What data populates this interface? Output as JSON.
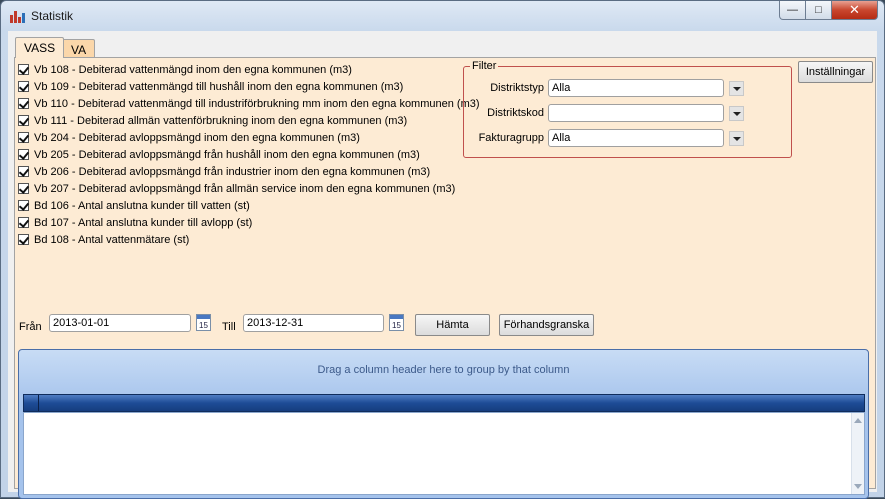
{
  "window": {
    "title": "Statistik",
    "controls": {
      "minimize": "—",
      "maximize": "□",
      "close": "✕"
    }
  },
  "tabs": [
    {
      "label": "VASS",
      "active": true
    },
    {
      "label": "VA",
      "active": false
    }
  ],
  "checkboxes": [
    {
      "label": "Vb 108 - Debiterad vattenmängd inom den egna kommunen (m3)",
      "checked": true
    },
    {
      "label": "Vb 109 - Debiterad vattenmängd till hushåll inom den egna kommunen (m3)",
      "checked": true
    },
    {
      "label": "Vb 110 - Debiterad vattenmängd till industriförbrukning mm inom den egna kommunen (m3)",
      "checked": true
    },
    {
      "label": "Vb 111 - Debiterad allmän vattenförbrukning inom den egna kommunen (m3)",
      "checked": true
    },
    {
      "label": "Vb 204 - Debiterad avloppsmängd inom den egna kommunen (m3)",
      "checked": true
    },
    {
      "label": "Vb 205 - Debiterad avloppsmängd från hushåll inom den egna kommunen (m3)",
      "checked": true
    },
    {
      "label": "Vb 206 - Debiterad avloppsmängd från industrier inom den egna kommunen (m3)",
      "checked": true
    },
    {
      "label": "Vb 207 - Debiterad avloppsmängd från allmän service inom den egna kommunen (m3)",
      "checked": true
    },
    {
      "label": "Bd 106 - Antal anslutna kunder till vatten (st)",
      "checked": true
    },
    {
      "label": "Bd 107 - Antal anslutna kunder till avlopp (st)",
      "checked": true
    },
    {
      "label": "Bd 108 - Antal vattenmätare (st)",
      "checked": true
    }
  ],
  "filter": {
    "legend": "Filter",
    "distriktstyp": {
      "label": "Distriktstyp",
      "value": "Alla"
    },
    "distriktskod": {
      "label": "Distriktskod",
      "value": ""
    },
    "fakturagrupp": {
      "label": "Fakturagrupp",
      "value": "Alla"
    }
  },
  "settings_button": "Inställningar",
  "dates": {
    "from_label": "Från",
    "from_value": "2013-01-01",
    "to_label": "Till",
    "to_value": "2013-12-31",
    "calendar_day": "15"
  },
  "buttons": {
    "fetch": "Hämta",
    "preview": "Förhandsgranska"
  },
  "grid": {
    "group_hint": "Drag a column header here to group by that column"
  }
}
